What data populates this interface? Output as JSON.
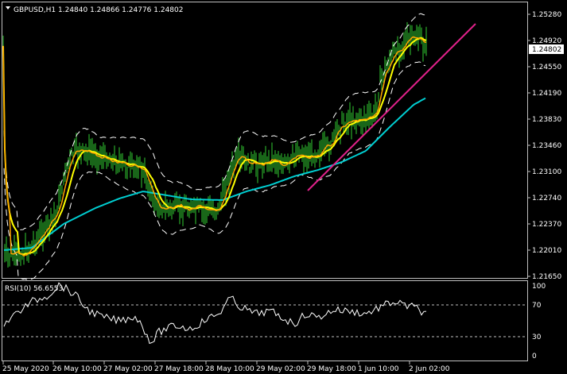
{
  "header": {
    "symbol_tf": "GBPUSD,H1",
    "open": "1.24840",
    "high": "1.24866",
    "low": "1.24776",
    "close": "1.24802"
  },
  "current_price": "1.24802",
  "price_axis": [
    "1.25280",
    "1.24920",
    "1.24550",
    "1.24190",
    "1.23830",
    "1.23460",
    "1.23100",
    "1.22740",
    "1.22370",
    "1.22010",
    "1.21650"
  ],
  "rsi": {
    "label": "RSI(10) 56.6553",
    "axis": [
      "100",
      "70",
      "30",
      "0"
    ],
    "levels": [
      70,
      30
    ]
  },
  "time_axis": [
    "25 May 2020",
    "26 May 10:00",
    "27 May 02:00",
    "27 May 18:00",
    "28 May 10:00",
    "29 May 02:00",
    "29 May 18:00",
    "1 Jun 10:00",
    "2 Jun 02:00"
  ],
  "colors": {
    "bars": "#32cd32",
    "ma_fast": "#ffa500",
    "ma_mid": "#ffff00",
    "ma_slow": "#00ced1",
    "bands": "#ffffff",
    "trendline": "#e0218a",
    "price_tag_bg": "#ffffff"
  }
}
